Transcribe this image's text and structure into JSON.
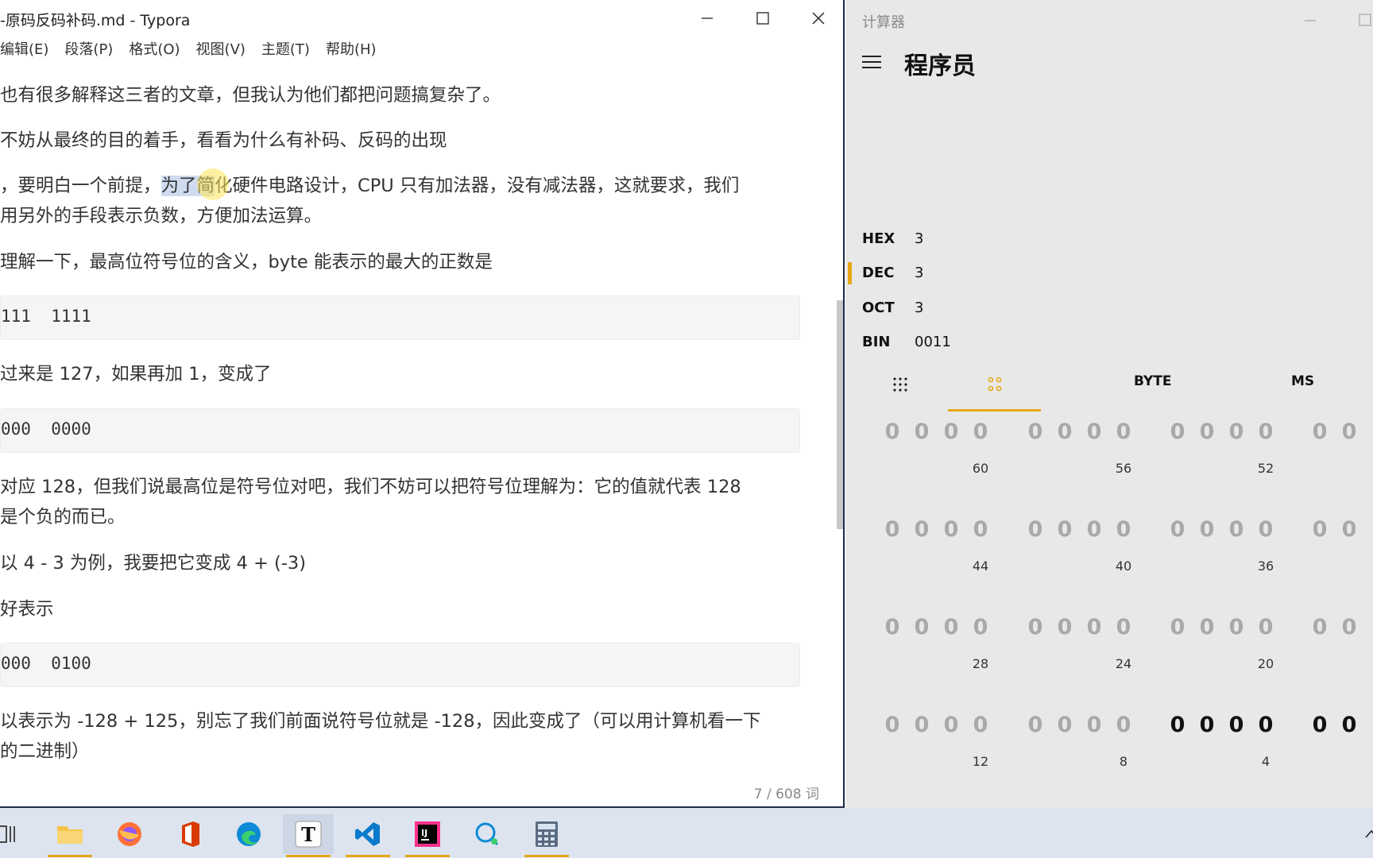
{
  "typora": {
    "title": "-原码反码补码.md - Typora",
    "menu": [
      "编辑(E)",
      "段落(P)",
      "格式(O)",
      "视图(V)",
      "主题(T)",
      "帮助(H)"
    ],
    "paragraphs": [
      "也有很多解释这三者的文章，但我认为他们都把问题搞复杂了。",
      "不妨从最终的目的着手，看看为什么有补码、反码的出现",
      "，要明白一个前提，",
      "为了简",
      "化硬件电路设计，CPU 只有加法器，没有减法器，这就要求，我们",
      "用另外的手段表示负数，方便加法运算。",
      "理解一下，最高位符号位的含义，byte 能表示的最大的正数是",
      "过来是 127，如果再加 1，变成了",
      "对应 128，但我们说最高位是符号位对吧，我们不妨可以把符号位理解为：它的值就代表 128",
      "是个负的而已。",
      "以 4 - 3 为例，我要把它变成 4 + (-3)",
      "好表示",
      "以表示为 -128 + 125，别忘了我们前面说符号位就是 -128，因此变成了（可以用计算机看一下",
      "的二进制）"
    ],
    "code_blocks": [
      "111  1111",
      "000  0000",
      "000  0100"
    ],
    "word_count": "7 / 608 词"
  },
  "calculator": {
    "title": "计算器",
    "mode": "程序员",
    "radix": [
      {
        "label": "HEX",
        "value": "3"
      },
      {
        "label": "DEC",
        "value": "3"
      },
      {
        "label": "OCT",
        "value": "3"
      },
      {
        "label": "BIN",
        "value": "0011"
      }
    ],
    "tabs": {
      "word_size": "BYTE",
      "memory": "MS"
    },
    "bit_labels": [
      [
        "60",
        "56",
        "52"
      ],
      [
        "44",
        "40",
        "36"
      ],
      [
        "28",
        "24",
        "20"
      ],
      [
        "12",
        "8",
        "4"
      ]
    ],
    "bit_digit": "0",
    "accent": "#e6a817"
  },
  "taskbar": {
    "apps": [
      "search-icon",
      "file-explorer-icon",
      "firefox-icon",
      "office-icon",
      "edge-icon",
      "typora-icon",
      "vscode-icon",
      "intellij-icon",
      "quick-assist-icon",
      "calculator-icon"
    ]
  }
}
